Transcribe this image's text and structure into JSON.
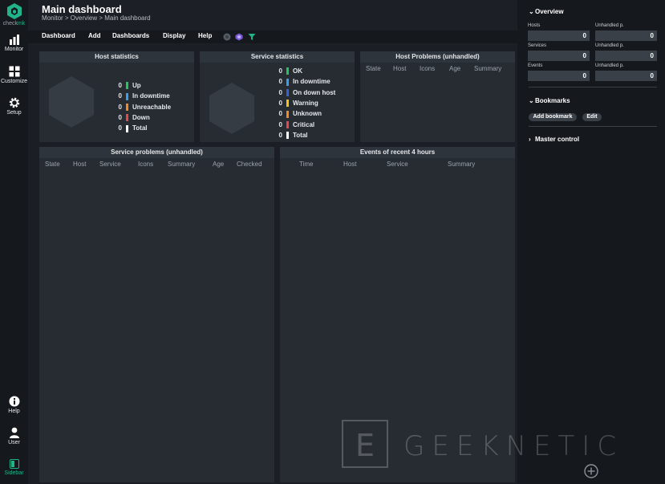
{
  "app": {
    "logo_text_a": "check",
    "logo_text_b": "mk"
  },
  "leftnav": {
    "monitor": "Monitor",
    "customize": "Customize",
    "setup": "Setup",
    "help": "Help",
    "user": "User",
    "sidebar": "Sidebar"
  },
  "header": {
    "title": "Main dashboard",
    "breadcrumb": "Monitor > Overview > Main dashboard"
  },
  "menu": {
    "dashboard": "Dashboard",
    "add": "Add",
    "dashboards": "Dashboards",
    "display": "Display",
    "help": "Help"
  },
  "host_statistics": {
    "title": "Host statistics",
    "rows": [
      {
        "count": "0",
        "label": "Up",
        "color": "#22c55e"
      },
      {
        "count": "0",
        "label": "In downtime",
        "color": "#3b9eea"
      },
      {
        "count": "0",
        "label": "Unreachable",
        "color": "#f08a24"
      },
      {
        "count": "0",
        "label": "Down",
        "color": "#e5484d"
      },
      {
        "count": "0",
        "label": "Total",
        "color": "#ffffff"
      }
    ]
  },
  "service_statistics": {
    "title": "Service statistics",
    "rows": [
      {
        "count": "0",
        "label": "OK",
        "color": "#22c55e"
      },
      {
        "count": "0",
        "label": "In downtime",
        "color": "#3b9eea"
      },
      {
        "count": "0",
        "label": "On down host",
        "color": "#3464d4"
      },
      {
        "count": "0",
        "label": "Warning",
        "color": "#f5c518"
      },
      {
        "count": "0",
        "label": "Unknown",
        "color": "#f08a24"
      },
      {
        "count": "0",
        "label": "Critical",
        "color": "#e5484d"
      },
      {
        "count": "0",
        "label": "Total",
        "color": "#ffffff"
      }
    ]
  },
  "host_problems": {
    "title": "Host Problems (unhandled)",
    "columns": [
      "State",
      "Host",
      "Icons",
      "Age",
      "Summary"
    ]
  },
  "service_problems": {
    "title": "Service problems (unhandled)",
    "columns": [
      "State",
      "Host",
      "Service",
      "Icons",
      "Summary",
      "Age",
      "Checked"
    ]
  },
  "events": {
    "title": "Events of recent 4 hours",
    "columns": [
      "Time",
      "Host",
      "Service",
      "Summary"
    ]
  },
  "sidebar": {
    "overview": {
      "title": "Overview",
      "rows": [
        {
          "label": "Hosts",
          "value": "0",
          "label2": "Unhandled p.",
          "value2": "0"
        },
        {
          "label": "Services",
          "value": "0",
          "label2": "Unhandled p.",
          "value2": "0"
        },
        {
          "label": "Events",
          "value": "0",
          "label2": "Unhandled p.",
          "value2": "0"
        }
      ]
    },
    "bookmarks": {
      "title": "Bookmarks",
      "add_label": "Add bookmark",
      "edit_label": "Edit"
    },
    "master_control": {
      "title": "Master control"
    }
  },
  "watermark": {
    "text": "GEEKNETIC",
    "letter": "E"
  },
  "colors": {
    "brand": "#21b38a",
    "background": "#1e2228",
    "nav": "#15191e"
  }
}
